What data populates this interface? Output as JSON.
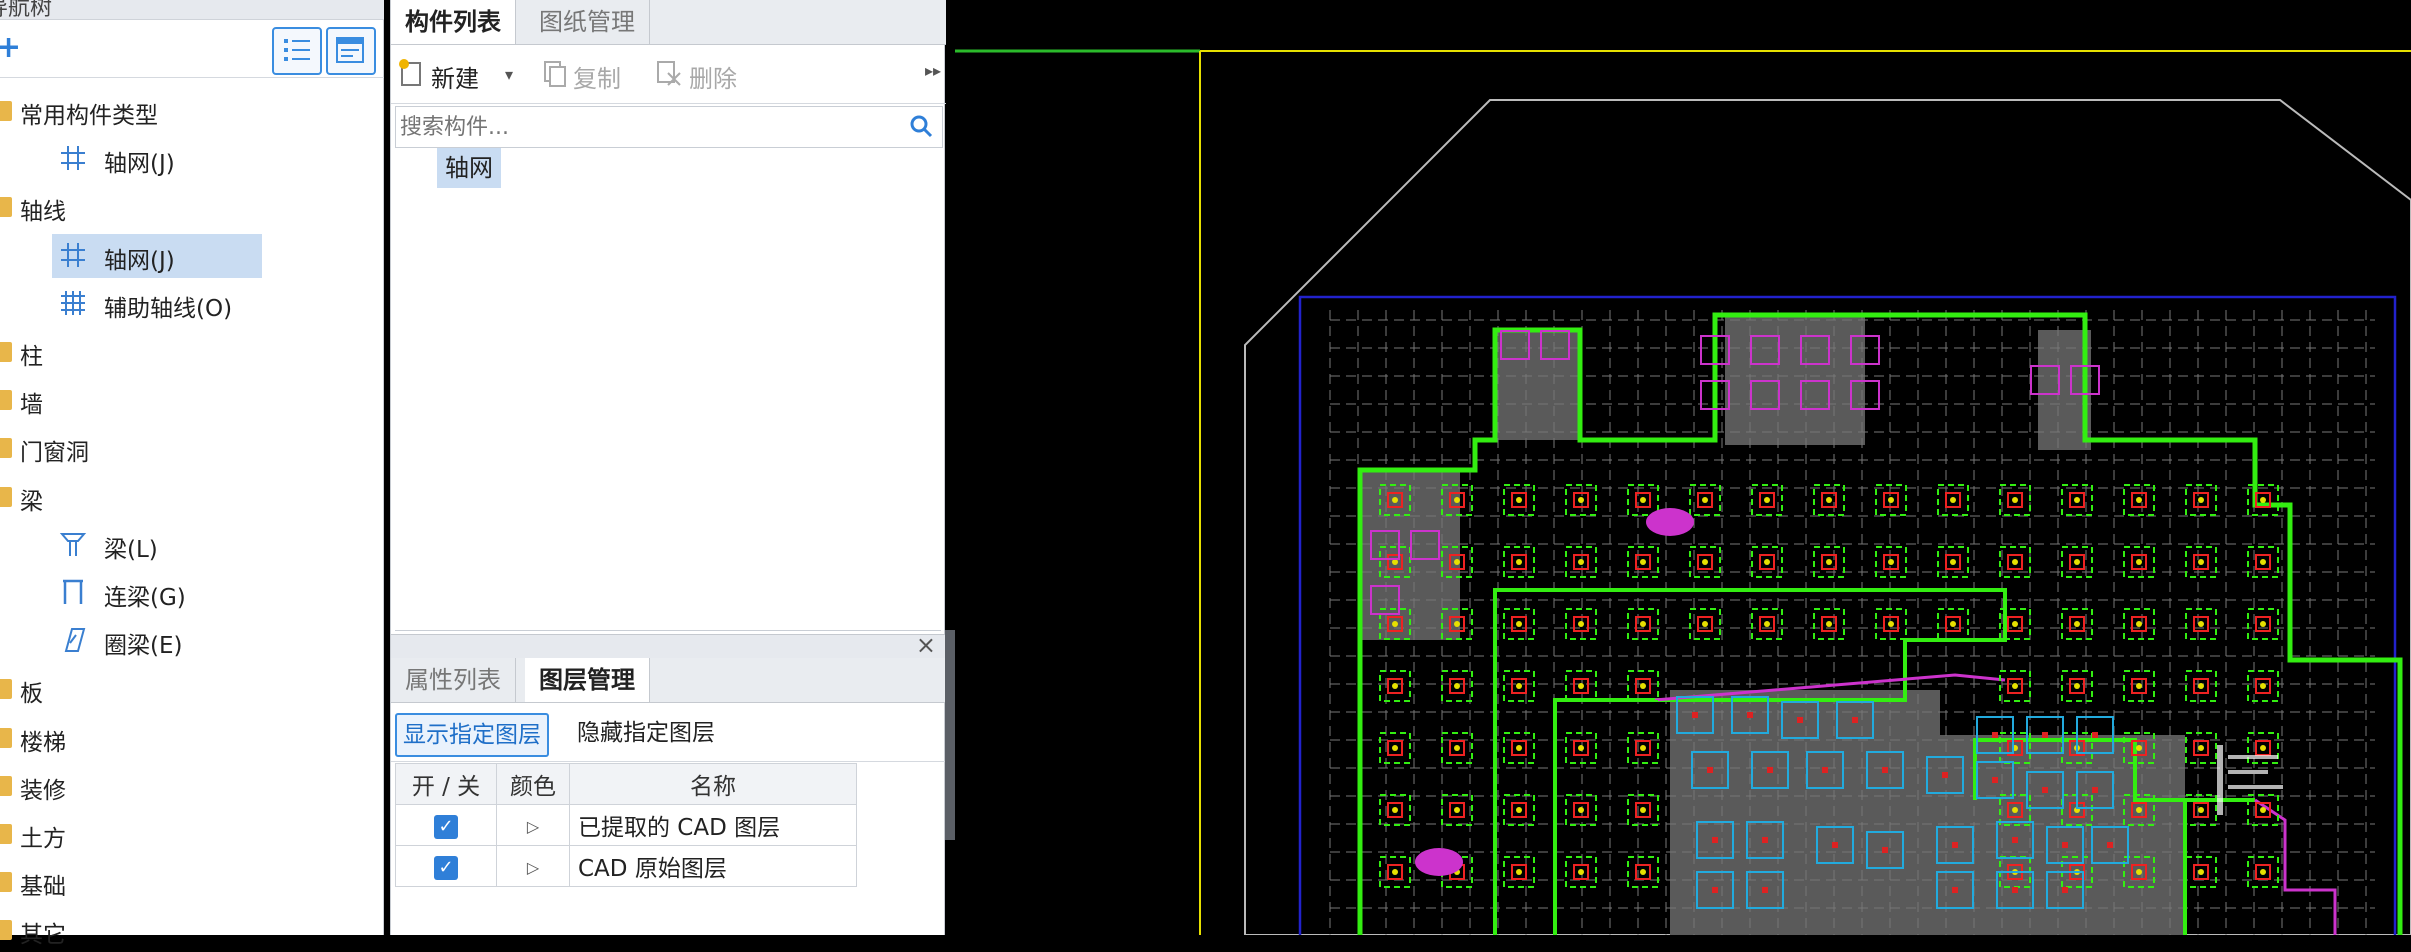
{
  "nav": {
    "header": "导航树",
    "tree": [
      {
        "label": "常用构件类型",
        "level": 0
      },
      {
        "label": "轴网(J)",
        "level": 1,
        "icon": "grid-icon"
      },
      {
        "label": "轴线",
        "level": 0
      },
      {
        "label": "轴网(J)",
        "level": 1,
        "icon": "grid-icon",
        "selected": true
      },
      {
        "label": "辅助轴线(O)",
        "level": 1,
        "icon": "aux-grid-icon"
      },
      {
        "label": "柱",
        "level": 0
      },
      {
        "label": "墙",
        "level": 0
      },
      {
        "label": "门窗洞",
        "level": 0
      },
      {
        "label": "梁",
        "level": 0
      },
      {
        "label": "梁(L)",
        "level": 1,
        "icon": "beam-icon"
      },
      {
        "label": "连梁(G)",
        "level": 1,
        "icon": "link-beam-icon"
      },
      {
        "label": "圈梁(E)",
        "level": 1,
        "icon": "ring-beam-icon"
      },
      {
        "label": "板",
        "level": 0
      },
      {
        "label": "楼梯",
        "level": 0
      },
      {
        "label": "装修",
        "level": 0
      },
      {
        "label": "土方",
        "level": 0
      },
      {
        "label": "基础",
        "level": 0
      },
      {
        "label": "其它",
        "level": 0
      }
    ]
  },
  "components": {
    "tabs": [
      "构件列表",
      "图纸管理"
    ],
    "toolbar": {
      "new": "新建",
      "copy": "复制",
      "delete": "删除"
    },
    "search_placeholder": "搜索构件...",
    "items": [
      "轴网"
    ]
  },
  "properties": {
    "tabs": [
      "属性列表",
      "图层管理"
    ],
    "show_layers": "显示指定图层",
    "hide_layers": "隐藏指定图层",
    "columns": [
      "开 / 关",
      "颜色",
      "名称"
    ],
    "layers": [
      {
        "name": "已提取的 CAD 图层",
        "on": true
      },
      {
        "name": "CAD 原始图层",
        "on": true
      }
    ]
  },
  "colors": {
    "accent": "#2f7fd8",
    "selection": "#c9dcf2",
    "cad_green": "#33ee11",
    "cad_magenta": "#cc33cc",
    "cad_cyan": "#22aadd",
    "cad_yellow": "#e6e000"
  }
}
